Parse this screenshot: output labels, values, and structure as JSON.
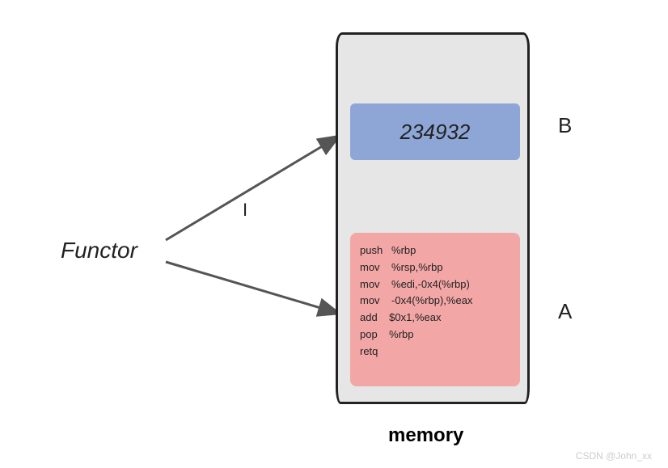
{
  "functor_label": "Functor",
  "cursor_marker": "I",
  "memory_label": "memory",
  "label_a": "A",
  "label_b": "B",
  "blue_box_value": "234932",
  "asm_lines": [
    "push   %rbp",
    "mov    %rsp,%rbp",
    "mov    %edi,-0x4(%rbp)",
    "mov    -0x4(%rbp),%eax",
    "add    $0x1,%eax",
    "pop    %rbp",
    "retq"
  ],
  "watermark": "CSDN @John_xx"
}
